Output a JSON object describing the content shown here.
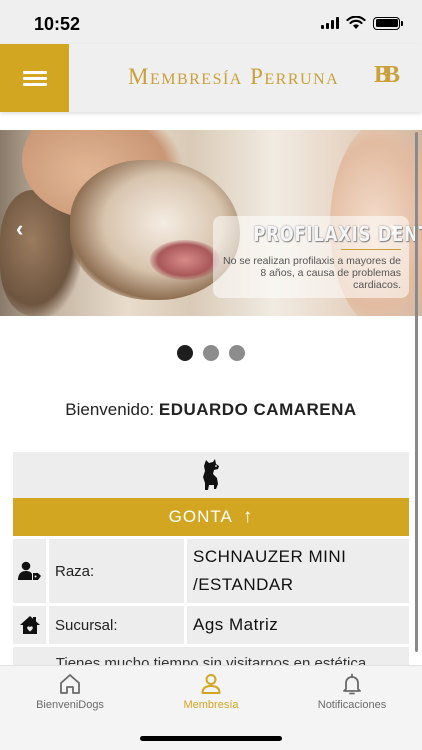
{
  "status_bar": {
    "time": "10:52"
  },
  "header": {
    "brand": "Membresía Perruna",
    "logo_text": "BB",
    "menu_icon": "hamburger-menu-icon"
  },
  "carousel": {
    "title": "PROFILAXIS DENTALES",
    "text": "No se realizan profilaxis a mayores de 8 años, a causa de problemas cardiacos.",
    "prev_glyph": "‹",
    "next_glyph": "›",
    "slide_count": 3,
    "active_slide": 1
  },
  "welcome": {
    "prefix": "Bienvenido:",
    "user_name": "EDUARDO CAMARENA"
  },
  "pet": {
    "name": "GONTA",
    "expand_glyph": "↑",
    "breed_label": "Raza:",
    "breed_value": "SCHNAUZER MINI /ESTANDAR",
    "branch_label": "Sucursal:",
    "branch_value": "Ags Matriz",
    "notice": "Tienes mucho tiempo sin visitarnos en estética"
  },
  "tabs": [
    {
      "label": "BienveniDogs",
      "icon": "home-icon",
      "active": false
    },
    {
      "label": "Membresía",
      "icon": "user-icon",
      "active": true
    },
    {
      "label": "Notificaciones",
      "icon": "bell-icon",
      "active": false
    }
  ],
  "colors": {
    "gold": "#d3a622",
    "brand_text": "#c9a03a",
    "panel": "#ededed"
  }
}
